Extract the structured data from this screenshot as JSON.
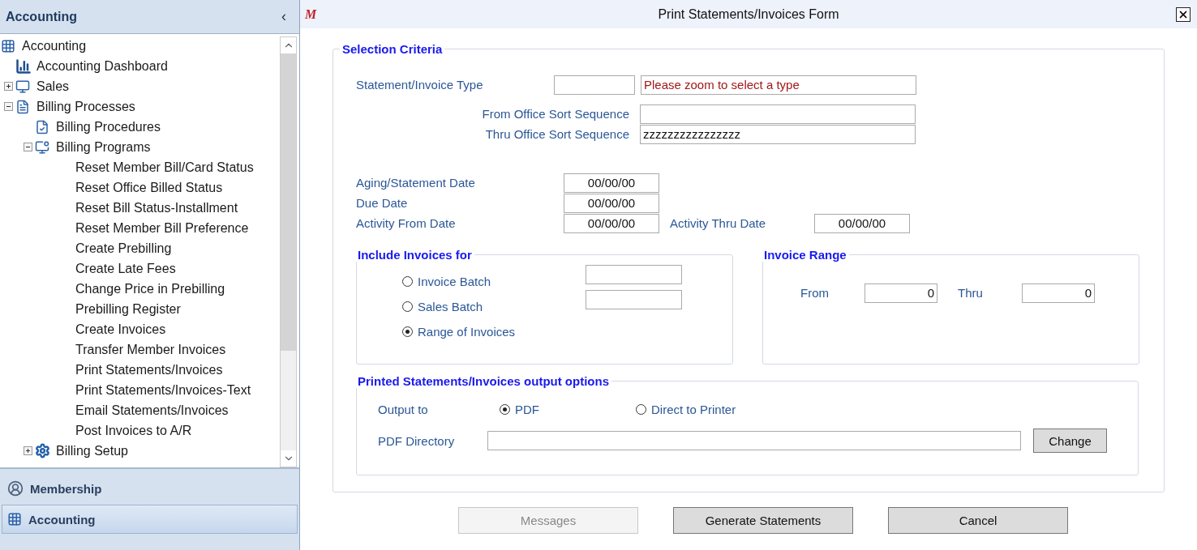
{
  "sidebar": {
    "title": "Accounting",
    "collapse_glyph": "‹",
    "tree": [
      {
        "label": "Accounting",
        "kind": "grid",
        "children": [
          {
            "label": "Accounting Dashboard",
            "kind": "chart"
          },
          {
            "label": "Sales",
            "kind": "screen",
            "expanded": false
          },
          {
            "label": "Billing Processes",
            "kind": "bill",
            "expanded": true,
            "children": [
              {
                "label": "Billing Procedures",
                "kind": "check"
              },
              {
                "label": "Billing Programs",
                "kind": "money",
                "expanded": true,
                "children": [
                  {
                    "label": "Reset Member Bill/Card Status"
                  },
                  {
                    "label": "Reset Office Billed Status"
                  },
                  {
                    "label": "Reset Bill Status-Installment"
                  },
                  {
                    "label": "Reset Member Bill Preference"
                  },
                  {
                    "label": "Create Prebilling"
                  },
                  {
                    "label": "Create Late Fees"
                  },
                  {
                    "label": "Change Price in Prebilling"
                  },
                  {
                    "label": "Prebilling Register"
                  },
                  {
                    "label": "Create Invoices"
                  },
                  {
                    "label": "Transfer Member Invoices"
                  },
                  {
                    "label": "Print Statements/Invoices"
                  },
                  {
                    "label": "Print Statements/Invoices-Text"
                  },
                  {
                    "label": "Email Statements/Invoices"
                  },
                  {
                    "label": "Post Invoices to A/R"
                  }
                ]
              },
              {
                "label": "Billing Setup",
                "kind": "gear",
                "expanded": false
              }
            ]
          }
        ]
      }
    ],
    "nav": [
      {
        "label": "Membership",
        "kind": "person",
        "selected": false
      },
      {
        "label": "Accounting",
        "kind": "grid",
        "selected": true
      }
    ]
  },
  "dialog": {
    "logo": "M",
    "title": "Print Statements/Invoices Form",
    "selection": {
      "legend": "Selection Criteria",
      "type_label": "Statement/Invoice Type",
      "type_message": "Please zoom to select a type",
      "from_label": "From Office Sort Sequence",
      "thru_label": "Thru Office Sort Sequence",
      "thru_value": "zzzzzzzzzzzzzzzz",
      "dates": [
        {
          "label": "Aging/Statement Date",
          "value": "00/00/00"
        },
        {
          "label": "Due Date",
          "value": "00/00/00"
        },
        {
          "label": "Activity From Date",
          "value": "00/00/00"
        }
      ],
      "activity_thru": {
        "label": "Activity Thru Date",
        "value": "00/00/00"
      }
    },
    "include": {
      "legend": "Include Invoices for",
      "options": [
        {
          "label": "Invoice Batch",
          "selected": false
        },
        {
          "label": "Sales Batch",
          "selected": false
        },
        {
          "label": "Range of Invoices",
          "selected": true
        }
      ]
    },
    "range": {
      "legend": "Invoice Range",
      "from_label": "From",
      "from_value": "0",
      "thru_label": "Thru",
      "thru_value": "0"
    },
    "output": {
      "legend": "Printed Statements/Invoices output options",
      "label": "Output to",
      "options": [
        {
          "label": "PDF",
          "selected": true
        },
        {
          "label": "Direct to Printer",
          "selected": false
        }
      ],
      "dir_label": "PDF Directory",
      "change": "Change"
    },
    "buttons": [
      {
        "label": "Messages",
        "disabled": true
      },
      {
        "label": "Generate Statements",
        "disabled": false
      },
      {
        "label": "Cancel",
        "disabled": false
      }
    ]
  }
}
